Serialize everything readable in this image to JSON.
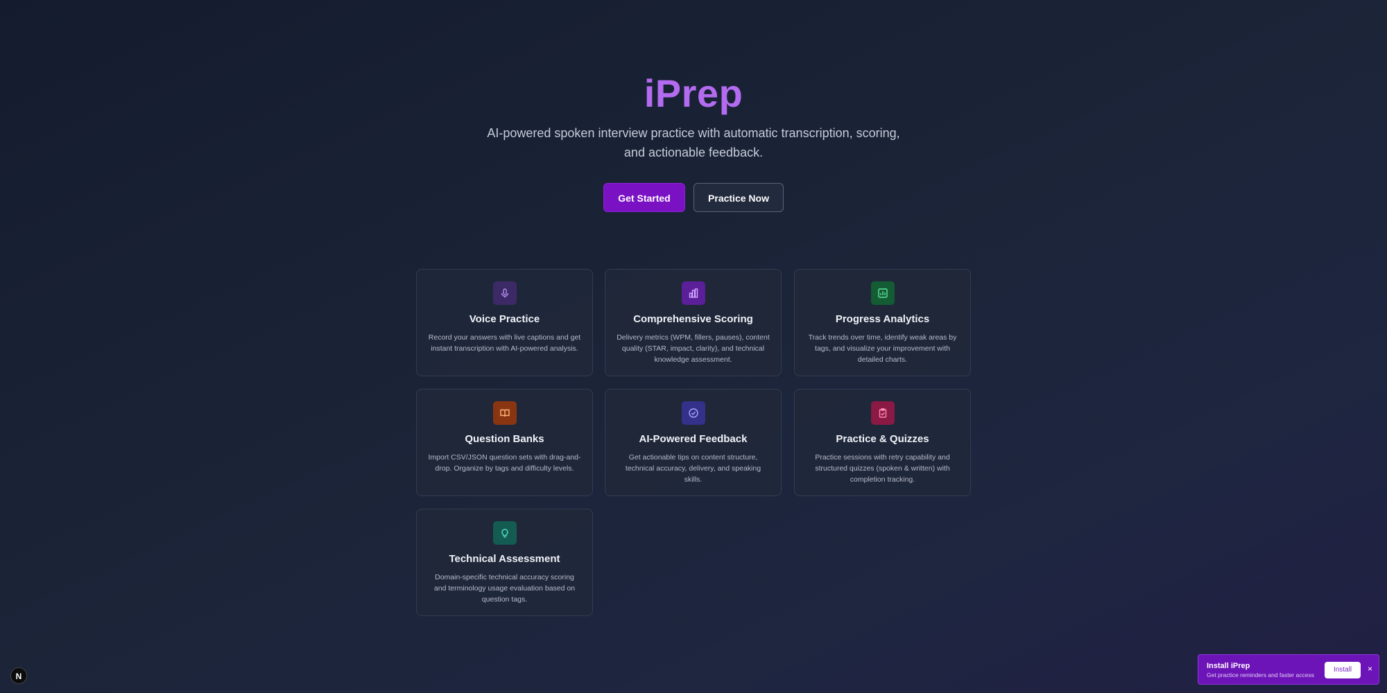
{
  "hero": {
    "title": "iPrep",
    "subtitle": "AI-powered spoken interview practice with automatic transcription, scoring, and actionable feedback.",
    "primary_button": "Get Started",
    "secondary_button": "Practice Now"
  },
  "features": [
    {
      "title": "Voice Practice",
      "description": "Record your answers with live captions and get instant transcription with AI-powered analysis.",
      "icon": "microphone-icon",
      "color": "#3b2a66"
    },
    {
      "title": "Comprehensive Scoring",
      "description": "Delivery metrics (WPM, fillers, pauses), content quality (STAR, impact, clarity), and technical knowledge assessment.",
      "icon": "bar-chart-icon",
      "color": "#5a1f99"
    },
    {
      "title": "Progress Analytics",
      "description": "Track trends over time, identify weak areas by tags, and visualize your improvement with detailed charts.",
      "icon": "analytics-icon",
      "color": "#145c34"
    },
    {
      "title": "Question Banks",
      "description": "Import CSV/JSON question sets with drag-and-drop. Organize by tags and difficulty levels.",
      "icon": "book-icon",
      "color": "#8a3512"
    },
    {
      "title": "AI-Powered Feedback",
      "description": "Get actionable tips on content structure, technical accuracy, delivery, and speaking skills.",
      "icon": "check-circle-icon",
      "color": "#33318a"
    },
    {
      "title": "Practice & Quizzes",
      "description": "Practice sessions with retry capability and structured quizzes (spoken & written) with completion tracking.",
      "icon": "clipboard-check-icon",
      "color": "#8a1a44"
    },
    {
      "title": "Technical Assessment",
      "description": "Domain-specific technical accuracy scoring and terminology usage evaluation based on question tags.",
      "icon": "lightbulb-icon",
      "color": "#145c52"
    }
  ],
  "install_banner": {
    "title": "Install iPrep",
    "subtitle": "Get practice reminders and faster access",
    "button": "Install",
    "close": "×"
  },
  "badge": {
    "label": "N"
  }
}
